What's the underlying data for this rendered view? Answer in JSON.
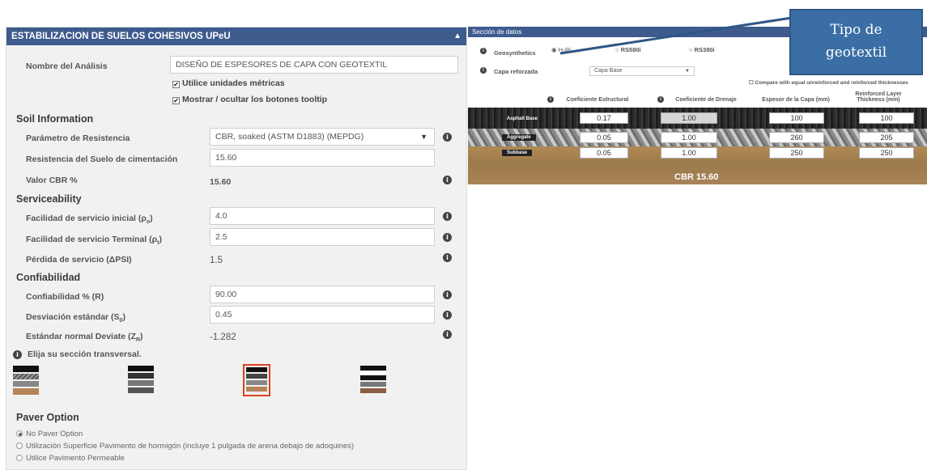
{
  "left_panel": {
    "title": "ESTABILIZACION DE SUELOS COHESIVOS UPeU",
    "analysis_name_label": "Nombre del Análisis",
    "analysis_name_value": "DISEÑO DE ESPESORES DE CAPA CON GEOTEXTIL",
    "metric_label": "Utilice unidades métricas",
    "tooltip_label": "Mostrar / ocultar los botones tooltip",
    "soil": {
      "heading": "Soil Information",
      "param_label": "Parámetro de Resistencia",
      "param_value": "CBR, soaked (ASTM D1883) (MEPDG)",
      "resistance_label": "Resistencia del Suelo de cimentación",
      "resistance_value": "15.60",
      "cbr_label": "Valor CBR %",
      "cbr_value": "15.60"
    },
    "service": {
      "heading": "Serviceability",
      "initial_label": "Facilidad de servicio inicial (ρ",
      "initial_sub": "o",
      "initial_value": "4.0",
      "terminal_label": "Facilidad de servicio Terminal (ρ",
      "terminal_sub": "t",
      "terminal_value": "2.5",
      "loss_label": "Pérdida de servicio (ΔPSI)",
      "loss_value": "1.5"
    },
    "conf": {
      "heading": "Confiabilidad",
      "reliability_label": "Confiabilidad % (R)",
      "reliability_value": "90.00",
      "std_label": "Desviación estándar (S",
      "std_sub": "0",
      "std_value": "0.45",
      "z_label": "Estándar normal Deviate (Z",
      "z_sub": "R",
      "z_value": "-1.282"
    },
    "cross_section_label": "Elija su sección transversal.",
    "paver": {
      "heading": "Paver Option",
      "options": [
        "No Paver Option",
        "Utilización Superficie Pavimento de hormigón (incluye 1 pulgada de arena debajo de adoquines)",
        "Utilice Pavimento Permeable"
      ]
    }
  },
  "right_panel": {
    "title": "Sección de datos",
    "geo_label": "Geosynthetics",
    "geo_options": [
      "H₂Ri",
      "RS580i",
      "RS380i"
    ],
    "layer_label": "Capa reforzada",
    "layer_value": "Capa Base",
    "compare_label": "Compare with equal unreinforced and reinforced thicknesses",
    "col_struct": "Coeficiente Estructural",
    "col_drain": "Coeficiente de Drenaje",
    "col_thick": "Espesor de la Capa (mm)",
    "col_reinf": "Reinforced Layer Thickness (mm)",
    "layers": [
      {
        "name": "Asphalt Base",
        "struct": "0.17",
        "drain": "1.00",
        "thick": "100",
        "reinf": "100"
      },
      {
        "name": "Aggregate",
        "struct": "0.05",
        "drain": "1.00",
        "thick": "260",
        "reinf": "205"
      },
      {
        "name": "Subbase",
        "struct": "0.05",
        "drain": "1.00",
        "thick": "250",
        "reinf": "250"
      }
    ],
    "cbr_text": "CBR  15.60"
  },
  "callout": {
    "line1": "Tipo de",
    "line2": "geotextil"
  },
  "colors": {
    "header": "#3e5b8e",
    "callout": "#3a6ea5",
    "selected_border": "#d9441c"
  }
}
